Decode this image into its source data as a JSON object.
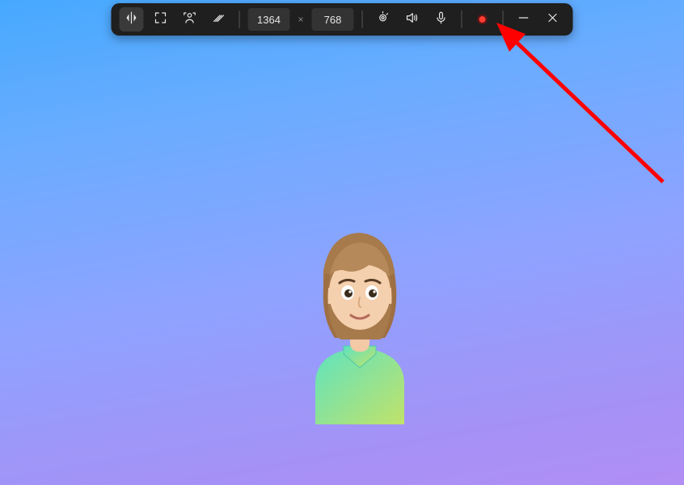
{
  "toolbar": {
    "width_value": "1364",
    "height_value": "768",
    "buttons": {
      "mirror": "mirror-icon",
      "fullscreen": "fullscreen-icon",
      "person": "person-crop-icon",
      "effects": "effects-icon",
      "camera": "camera-icon",
      "speaker": "speaker-icon",
      "microphone": "microphone-icon",
      "record": "record-icon",
      "minimize": "minimize-icon",
      "close": "close-icon"
    }
  },
  "avatar": {
    "description": "cartoon-female-avatar",
    "hair_color": "#a77a4b",
    "skin_color": "#f3c9a6",
    "shirt_gradient_start": "#5ee3c0",
    "shirt_gradient_end": "#c1e26a"
  },
  "annotation": {
    "arrow_color": "#ff0000",
    "target": "record-button"
  }
}
